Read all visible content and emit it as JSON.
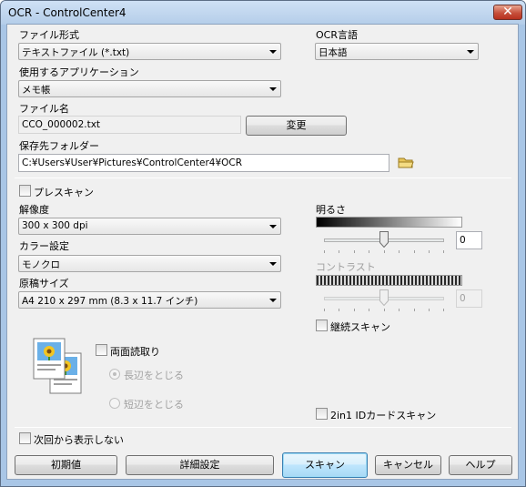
{
  "window": {
    "title": "OCR - ControlCenter4",
    "close_glyph": "✕"
  },
  "file_format": {
    "label": "ファイル形式",
    "value": "テキストファイル (*.txt)"
  },
  "ocr_language": {
    "label": "OCR言語",
    "value": "日本語"
  },
  "app": {
    "label": "使用するアプリケーション",
    "value": "メモ帳"
  },
  "file_name": {
    "label": "ファイル名",
    "value": "CCO_000002.txt",
    "change_button": "変更"
  },
  "save_folder": {
    "label": "保存先フォルダー",
    "value": "C:¥Users¥User¥Pictures¥ControlCenter4¥OCR",
    "icon": "folder-icon"
  },
  "prescan": {
    "label": "プレスキャン",
    "checked": false
  },
  "resolution": {
    "label": "解像度",
    "value": "300 x 300 dpi"
  },
  "color": {
    "label": "カラー設定",
    "value": "モノクロ"
  },
  "doc_size": {
    "label": "原稿サイズ",
    "value": "A4 210 x 297 mm (8.3 x 11.7 インチ)"
  },
  "brightness": {
    "label": "明るさ",
    "value": "0",
    "level_fraction": 0.5
  },
  "contrast": {
    "label": "コントラスト",
    "value": "0",
    "level_fraction": 0.5,
    "enabled": false
  },
  "continuous_scan": {
    "label": "継続スキャン",
    "checked": false
  },
  "duplex": {
    "label": "両面読取り",
    "checked": false,
    "long_edge": "長辺をとじる",
    "short_edge": "短辺をとじる",
    "selected": "long_edge",
    "icon": "duplex-document-icon"
  },
  "id_card_scan": {
    "label": "2in1 IDカードスキャン",
    "checked": false
  },
  "dont_show": {
    "label": "次回から表示しない",
    "checked": false
  },
  "buttons": {
    "defaults": "初期値",
    "advanced": "詳細設定",
    "scan": "スキャン",
    "cancel": "キャンセル",
    "help": "ヘルプ"
  },
  "colors": {
    "frame": "#a9c6e6",
    "dialog_bg": "#f0f0f0",
    "close_red": "#c7503c",
    "default_button": "#bee6fd"
  }
}
